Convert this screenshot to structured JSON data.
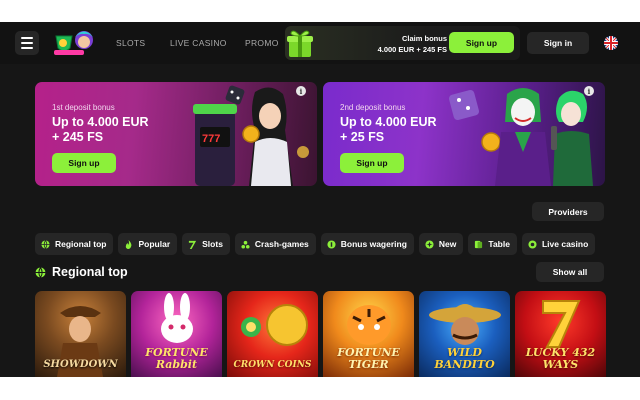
{
  "header": {
    "nav": [
      "SLOTS",
      "LIVE CASINO",
      "PROMO"
    ],
    "claim_title": "Claim bonus",
    "claim_amount": "4.000 EUR + 245 FS",
    "claim_button": "Sign up",
    "signin_button": "Sign in"
  },
  "banners": [
    {
      "subtitle": "1st deposit bonus",
      "line1": "Up to 4.000 EUR",
      "line2": "+ 245 FS",
      "button": "Sign up",
      "info": "i"
    },
    {
      "subtitle": "2nd deposit bonus",
      "line1": "Up to 4.000 EUR",
      "line2": "+ 25 FS",
      "button": "Sign up",
      "info": "i"
    }
  ],
  "providers_button": "Providers",
  "categories": [
    {
      "label": "Regional top",
      "icon": "globe-icon"
    },
    {
      "label": "Popular",
      "icon": "flame-icon"
    },
    {
      "label": "Slots",
      "icon": "seven-icon"
    },
    {
      "label": "Crash-games",
      "icon": "plane-icon"
    },
    {
      "label": "Bonus wagering",
      "icon": "coin-icon"
    },
    {
      "label": "New",
      "icon": "new-icon"
    },
    {
      "label": "Table",
      "icon": "cards-icon"
    },
    {
      "label": "Live casino",
      "icon": "live-icon"
    }
  ],
  "section": {
    "title": "Regional top",
    "show_all": "Show all"
  },
  "games": [
    {
      "title": "SHOWDOWN"
    },
    {
      "title": "FORTUNE Rabbit"
    },
    {
      "title": "CROWN COINS"
    },
    {
      "title": "FORTUNE TIGER"
    },
    {
      "title": "WILD BANDITO"
    },
    {
      "title": "LUCKY 432 WAYS"
    }
  ],
  "colors": {
    "accent": "#8cf03a",
    "background": "#161616",
    "chip": "#262626"
  }
}
